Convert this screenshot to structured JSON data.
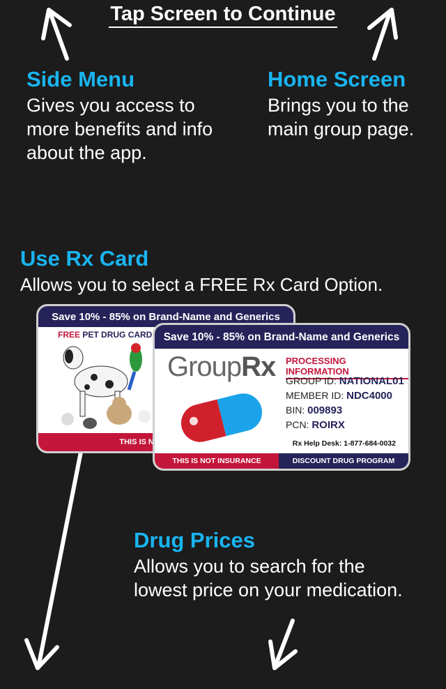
{
  "tap_label": "Tap Screen to Continue",
  "side_menu": {
    "title": "Side Menu",
    "lines": [
      "Gives you access to",
      "more benefits and info",
      "about the app."
    ]
  },
  "home_screen": {
    "title": "Home Screen",
    "lines": [
      "Brings you to the",
      "main group page."
    ]
  },
  "rx_card": {
    "title": "Use Rx Card",
    "desc": "Allows you to select a FREE Rx Card Option."
  },
  "drug_prices": {
    "title": "Drug Prices",
    "lines": [
      "Allows you to search for the",
      "lowest price on your medication."
    ]
  },
  "pet_card": {
    "banner": "Save 10% - 85% on Brand-Name and Generics",
    "title_free": "FREE",
    "title_rest": " PET DRUG CARD",
    "footer": "THIS IS NOT INSURANCE"
  },
  "grouprx_card": {
    "banner": "Save 10% - 85% on Brand-Name and Generics",
    "logo_light": "Group",
    "logo_bold": "Rx",
    "processing_title": "PROCESSING INFORMATION",
    "fields": [
      {
        "label": "GROUP ID:",
        "value": "NATIONAL01"
      },
      {
        "label": "MEMBER ID:",
        "value": "NDC4000"
      },
      {
        "label": "BIN:",
        "value": "009893"
      },
      {
        "label": "PCN:",
        "value": "ROIRX"
      }
    ],
    "help_desk": "Rx Help Desk: 1-877-684-0032",
    "footer_left": "THIS IS NOT INSURANCE",
    "footer_right": "DISCOUNT DRUG PROGRAM"
  },
  "colors": {
    "accent": "#19b4f0",
    "background": "#1c1c1c",
    "navy": "#26235a",
    "red": "#c3163a"
  }
}
